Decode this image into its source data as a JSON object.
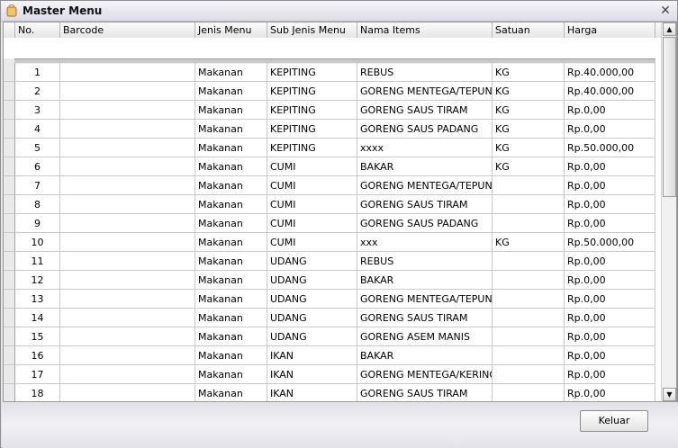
{
  "window": {
    "title": "Master Menu",
    "close_glyph": "✕",
    "icon": "app-icon"
  },
  "grid": {
    "columns": [
      "No.",
      "Barcode",
      "Jenis Menu",
      "Sub Jenis Menu",
      "Nama Items",
      "Satuan",
      "Harga"
    ],
    "rows": [
      {
        "no": "1",
        "barcode": "",
        "jenis": "Makanan",
        "sub": "KEPITING",
        "nama": "REBUS",
        "satuan": "KG",
        "harga": "Rp.40.000,00"
      },
      {
        "no": "2",
        "barcode": "",
        "jenis": "Makanan",
        "sub": "KEPITING",
        "nama": "GORENG MENTEGA/TEPUNG",
        "satuan": "KG",
        "harga": "Rp.40.000,00"
      },
      {
        "no": "3",
        "barcode": "",
        "jenis": "Makanan",
        "sub": "KEPITING",
        "nama": "GORENG SAUS TIRAM",
        "satuan": "KG",
        "harga": "Rp.0,00"
      },
      {
        "no": "4",
        "barcode": "",
        "jenis": "Makanan",
        "sub": "KEPITING",
        "nama": "GORENG SAUS PADANG",
        "satuan": "KG",
        "harga": "Rp.0,00"
      },
      {
        "no": "5",
        "barcode": "",
        "jenis": "Makanan",
        "sub": "KEPITING",
        "nama": "xxxx",
        "satuan": "KG",
        "harga": "Rp.50.000,00"
      },
      {
        "no": "6",
        "barcode": "",
        "jenis": "Makanan",
        "sub": "CUMI",
        "nama": "BAKAR",
        "satuan": "KG",
        "harga": "Rp.0,00"
      },
      {
        "no": "7",
        "barcode": "",
        "jenis": "Makanan",
        "sub": "CUMI",
        "nama": "GORENG MENTEGA/TEPUNG",
        "satuan": "",
        "harga": "Rp.0,00"
      },
      {
        "no": "8",
        "barcode": "",
        "jenis": "Makanan",
        "sub": "CUMI",
        "nama": "GORENG SAUS TIRAM",
        "satuan": "",
        "harga": "Rp.0,00"
      },
      {
        "no": "9",
        "barcode": "",
        "jenis": "Makanan",
        "sub": "CUMI",
        "nama": "GORENG SAUS PADANG",
        "satuan": "",
        "harga": "Rp.0,00"
      },
      {
        "no": "10",
        "barcode": "",
        "jenis": "Makanan",
        "sub": "CUMI",
        "nama": "xxx",
        "satuan": "KG",
        "harga": "Rp.50.000,00"
      },
      {
        "no": "11",
        "barcode": "",
        "jenis": "Makanan",
        "sub": "UDANG",
        "nama": "REBUS",
        "satuan": "",
        "harga": "Rp.0,00"
      },
      {
        "no": "12",
        "barcode": "",
        "jenis": "Makanan",
        "sub": "UDANG",
        "nama": "BAKAR",
        "satuan": "",
        "harga": "Rp.0,00"
      },
      {
        "no": "13",
        "barcode": "",
        "jenis": "Makanan",
        "sub": "UDANG",
        "nama": "GORENG MENTEGA/TEPUNG",
        "satuan": "",
        "harga": "Rp.0,00"
      },
      {
        "no": "14",
        "barcode": "",
        "jenis": "Makanan",
        "sub": "UDANG",
        "nama": "GORENG SAUS TIRAM",
        "satuan": "",
        "harga": "Rp.0,00"
      },
      {
        "no": "15",
        "barcode": "",
        "jenis": "Makanan",
        "sub": "UDANG",
        "nama": "GORENG ASEM MANIS",
        "satuan": "",
        "harga": "Rp.0,00"
      },
      {
        "no": "16",
        "barcode": "",
        "jenis": "Makanan",
        "sub": "IKAN",
        "nama": "BAKAR",
        "satuan": "",
        "harga": "Rp.0,00"
      },
      {
        "no": "17",
        "barcode": "",
        "jenis": "Makanan",
        "sub": "IKAN",
        "nama": "GORENG MENTEGA/KERING",
        "satuan": "",
        "harga": "Rp.0,00"
      },
      {
        "no": "18",
        "barcode": "",
        "jenis": "Makanan",
        "sub": "IKAN",
        "nama": "GORENG SAUS TIRAM",
        "satuan": "",
        "harga": "Rp.0,00"
      }
    ]
  },
  "scrollbar": {
    "up_glyph": "▲",
    "down_glyph": "▼"
  },
  "footer": {
    "keluar_label": "Keluar"
  }
}
